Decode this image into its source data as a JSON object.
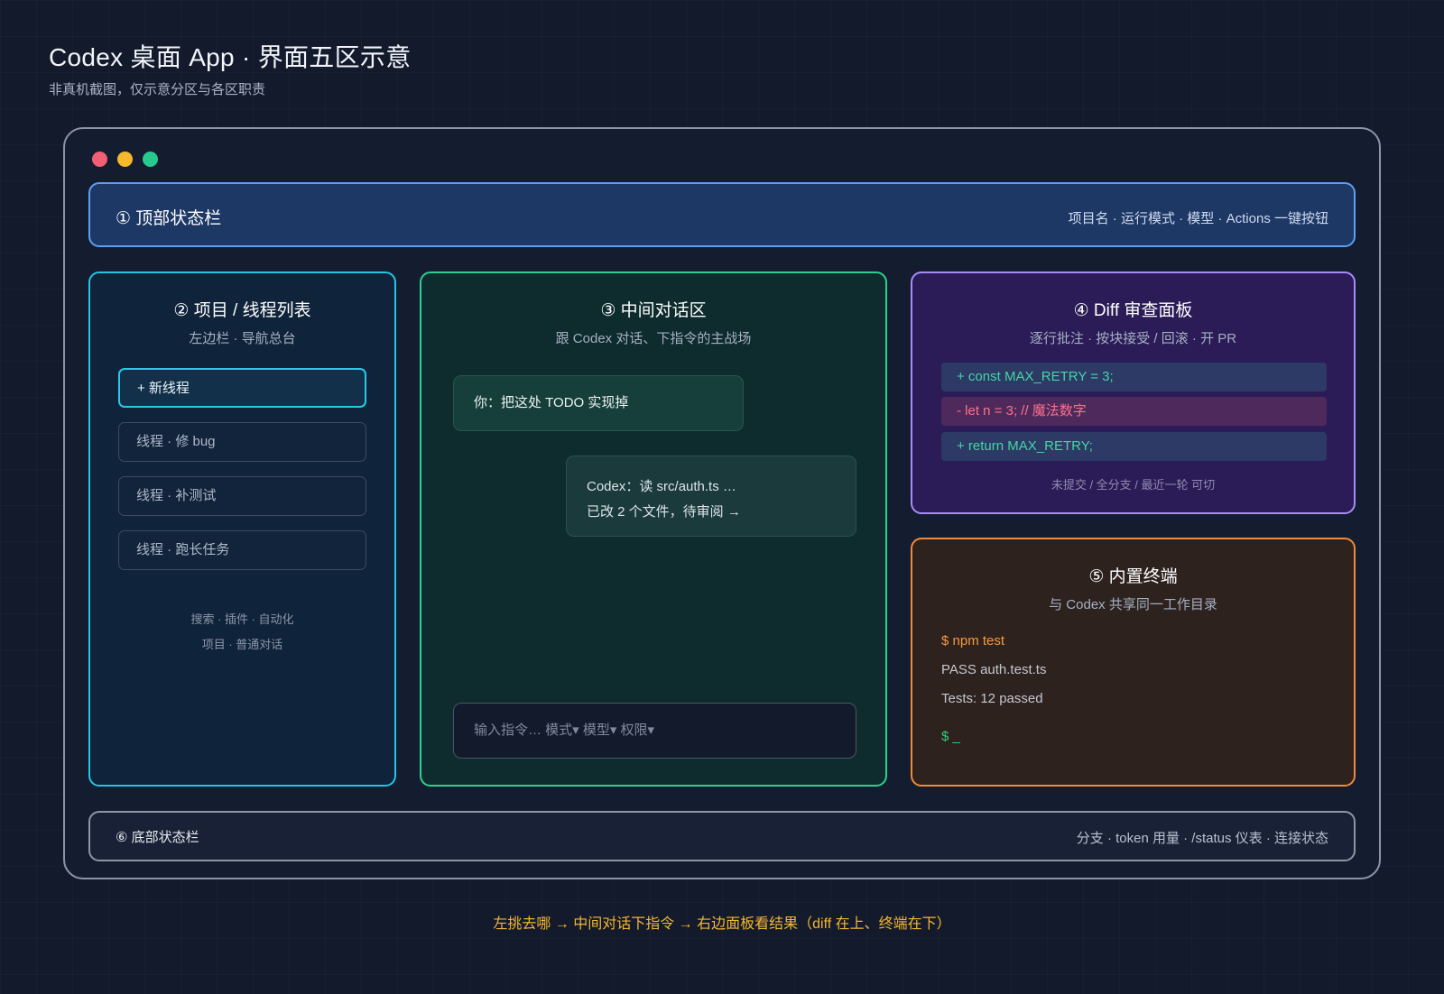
{
  "header": {
    "title": "Codex 桌面 App · 界面五区示意",
    "subtitle": "非真机截图，仅示意分区与各区职责"
  },
  "colors": {
    "background": "#121a2b",
    "top_bar_accent": "#5e9ef4",
    "threads_accent": "#25c4e4",
    "chat_accent": "#2ed08f",
    "diff_accent": "#a78bfa",
    "terminal_accent": "#f08a36",
    "caption": "#f5b630"
  },
  "window": {
    "controls": [
      "close",
      "minimize",
      "maximize"
    ]
  },
  "top_bar": {
    "title": "① 顶部状态栏",
    "description": "项目名 · 运行模式 · 模型 · Actions 一键按钮"
  },
  "threads_panel": {
    "title": "② 项目 / 线程列表",
    "subtitle": "左边栏 · 导航总台",
    "new_thread_label": "+ 新线程",
    "threads": [
      "线程 · 修 bug",
      "线程 · 补测试",
      "线程 · 跑长任务"
    ],
    "footer_line1": "搜索 · 插件 · 自动化",
    "footer_line2": "项目 · 普通对话"
  },
  "chat_panel": {
    "title": "③ 中间对话区",
    "subtitle": "跟 Codex 对话、下指令的主战场",
    "user_message": "你：把这处 TODO 实现掉",
    "codex_line1": "Codex：读 src/auth.ts …",
    "codex_line2": "已改 2 个文件，待审阅 →",
    "input_placeholder": "输入指令… 模式▾ 模型▾ 权限▾"
  },
  "diff_panel": {
    "title": "④ Diff 审查面板",
    "subtitle": "逐行批注 · 按块接受 / 回滚 · 开 PR",
    "lines": [
      {
        "type": "add",
        "text": "+ const MAX_RETRY = 3;"
      },
      {
        "type": "del",
        "text": "- let n = 3; // 魔法数字"
      },
      {
        "type": "add",
        "text": "+ return MAX_RETRY;"
      }
    ],
    "footer": "未提交 / 全分支 / 最近一轮 可切"
  },
  "terminal_panel": {
    "title": "⑤ 内置终端",
    "subtitle": "与 Codex 共享同一工作目录",
    "command": "$ npm test",
    "output_line1": "PASS auth.test.ts",
    "output_line2": "Tests: 12 passed",
    "prompt": "$ _"
  },
  "bottom_bar": {
    "title": "⑥ 底部状态栏",
    "description": "分支 · token 用量 · /status 仪表 · 连接状态"
  },
  "footer_caption": "左挑去哪 → 中间对话下指令 → 右边面板看结果（diff 在上、终端在下）"
}
